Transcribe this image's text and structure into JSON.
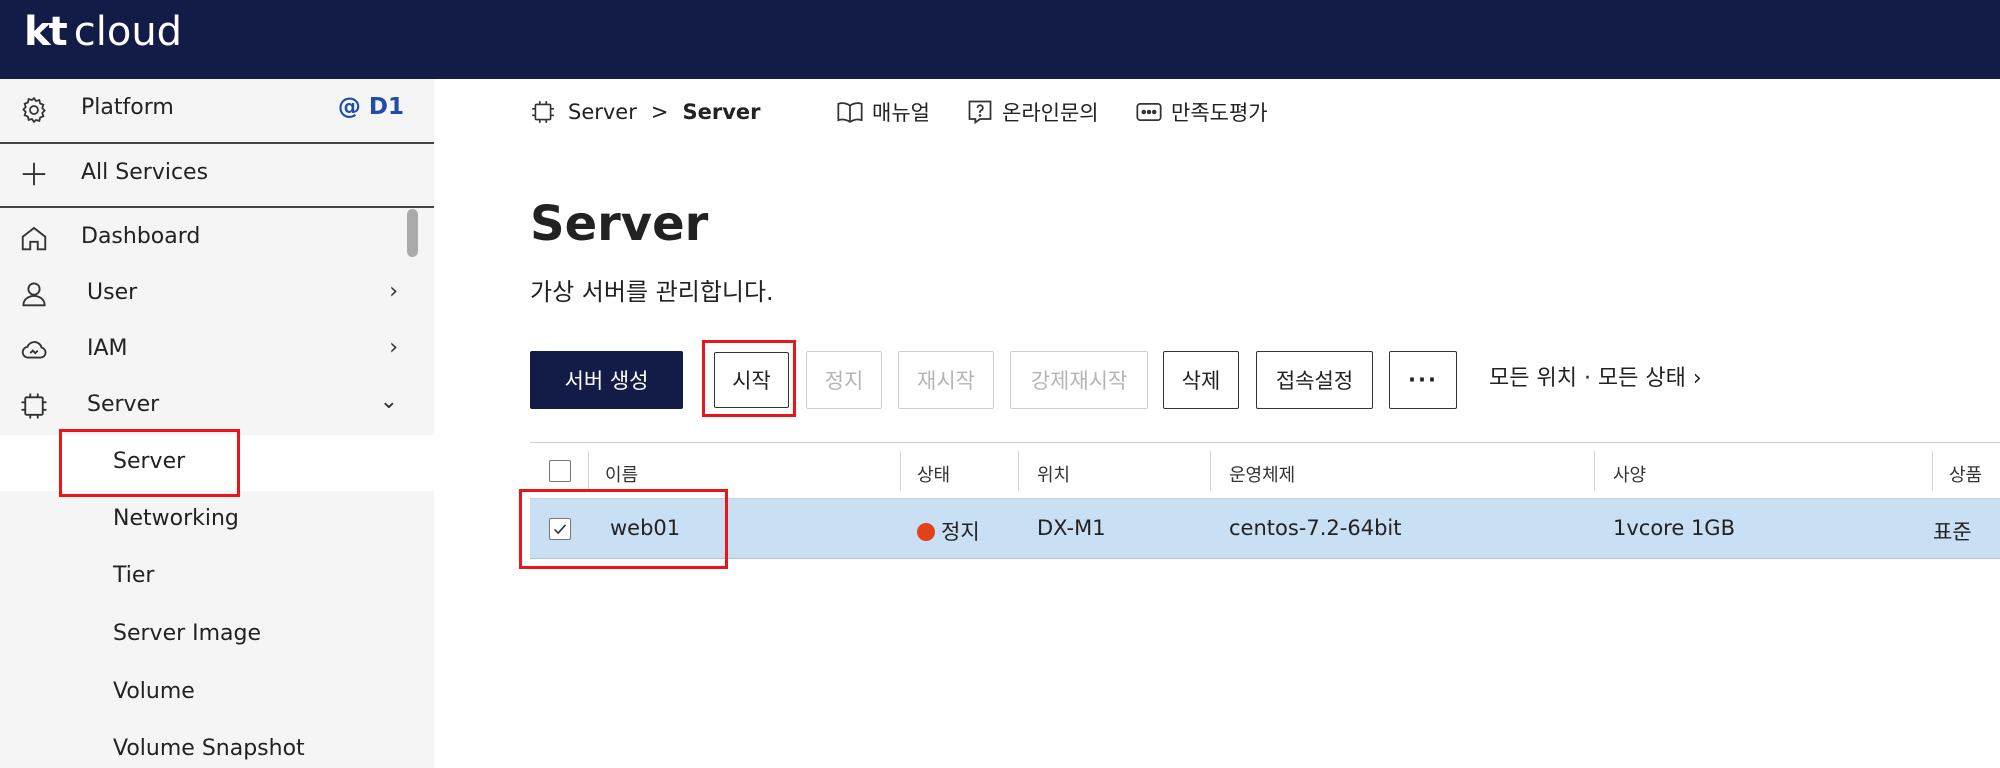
{
  "topbar": {
    "logo_kt": "kt",
    "logo_cloud": "cloud",
    "background": "#131c47"
  },
  "sidebar": {
    "platform_label": "Platform",
    "platform_badge": "@ D1",
    "all_services_label": "All Services",
    "items": [
      {
        "label": "Dashboard",
        "icon": "home-icon"
      },
      {
        "label": "User",
        "icon": "user-icon",
        "arrow": "›"
      },
      {
        "label": "IAM",
        "icon": "cloud-iam-icon",
        "arrow": "›"
      },
      {
        "label": "Server",
        "icon": "chip-icon",
        "arrow": "⌄"
      }
    ],
    "sub_items": [
      {
        "label": "Server"
      },
      {
        "label": "Networking"
      },
      {
        "label": "Tier"
      },
      {
        "label": "Server Image"
      },
      {
        "label": "Volume"
      },
      {
        "label": "Volume Snapshot"
      }
    ]
  },
  "breadcrumb": {
    "parent": "Server",
    "separator": ">",
    "current": "Server"
  },
  "top_links": {
    "manual": "매뉴얼",
    "inquiry": "온라인문의",
    "survey": "만족도평가"
  },
  "page": {
    "title": "Server",
    "subtitle": "가상 서버를 관리합니다."
  },
  "toolbar": {
    "create": "서버 생성",
    "start": "시작",
    "stop": "정지",
    "restart": "재시작",
    "force_restart": "강제재시작",
    "delete": "삭제",
    "connection": "접속설정",
    "more": "···",
    "filter": "모든 위치 · 모든 상태 ›"
  },
  "table": {
    "columns": [
      "이름",
      "상태",
      "위치",
      "운영체제",
      "사양",
      "상품"
    ],
    "rows": [
      {
        "checked": true,
        "name": "web01",
        "status": "정지",
        "status_color": "#e2421a",
        "location": "DX-M1",
        "os": "centos-7.2-64bit",
        "spec": "1vcore 1GB",
        "product": "표준"
      }
    ]
  },
  "colors": {
    "primary": "#131c47",
    "highlight": "#e8161b",
    "selected_row": "#c9dff3",
    "badge": "#1f4ea8"
  }
}
